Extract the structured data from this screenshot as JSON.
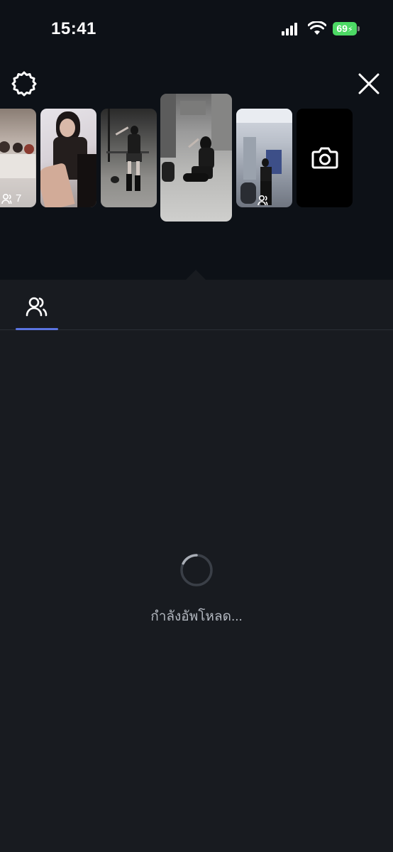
{
  "status_bar": {
    "time": "15:41",
    "battery_level": "69",
    "signal_icon": "cellular-signal-icon",
    "wifi_icon": "wifi-icon",
    "battery_charging": true
  },
  "toolbar": {
    "settings_icon": "gear-icon",
    "close_icon": "close-icon"
  },
  "media_strip": {
    "items": [
      {
        "type": "photo",
        "subject": "group photo",
        "tagged_count": "7"
      },
      {
        "type": "photo",
        "subject": "selfie"
      },
      {
        "type": "photo",
        "subject": "dancer in parking garage"
      },
      {
        "type": "photo",
        "subject": "kneeling pose",
        "selected": true
      },
      {
        "type": "photo",
        "subject": "mirror selfie in hallway",
        "tagged": true
      }
    ],
    "camera_icon": "camera-icon"
  },
  "tabs": [
    {
      "icon": "people-icon",
      "active": true
    }
  ],
  "upload": {
    "status_text": "กำลังอัพโหลด...",
    "spinner_icon": "loading-spinner-icon"
  },
  "colors": {
    "top_background": "#0d1117",
    "panel_background": "#181b20",
    "tab_indicator": "#5b74e0",
    "battery": "#4cd964"
  }
}
